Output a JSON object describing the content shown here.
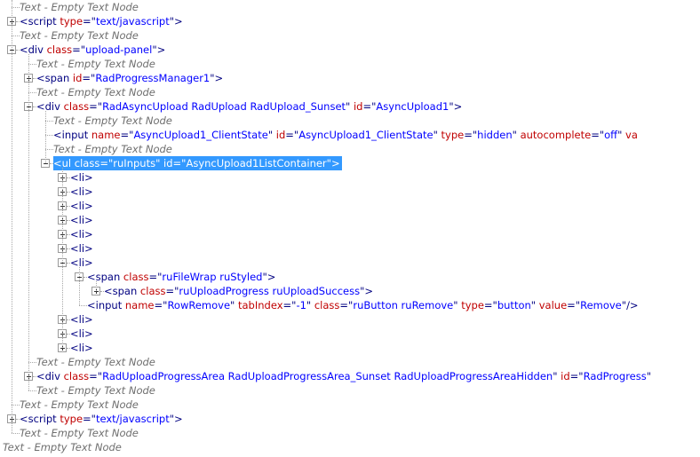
{
  "dom_tree": {
    "nodes": [
      {
        "depth": 0,
        "kind": "text",
        "text": "Text - Empty Text Node"
      },
      {
        "depth": 0,
        "kind": "element",
        "toggle": "collapsed",
        "tag": "script",
        "attrs": [
          {
            "name": "type",
            "value": "text/javascript"
          }
        ],
        "close": ">"
      },
      {
        "depth": 0,
        "kind": "text",
        "text": "Text - Empty Text Node"
      },
      {
        "depth": 0,
        "kind": "element",
        "toggle": "expanded",
        "tag": "div",
        "attrs": [
          {
            "name": "class",
            "value": "upload-panel"
          }
        ],
        "close": ">"
      },
      {
        "depth": 1,
        "kind": "text",
        "text": "Text - Empty Text Node"
      },
      {
        "depth": 1,
        "kind": "element",
        "toggle": "collapsed",
        "tag": "span",
        "attrs": [
          {
            "name": "id",
            "value": "RadProgressManager1"
          }
        ],
        "close": ">"
      },
      {
        "depth": 1,
        "kind": "text",
        "text": "Text - Empty Text Node"
      },
      {
        "depth": 1,
        "kind": "element",
        "toggle": "expanded",
        "tag": "div",
        "attrs": [
          {
            "name": "class",
            "value": "RadAsyncUpload RadUpload RadUpload_Sunset"
          },
          {
            "name": "id",
            "value": "AsyncUpload1"
          }
        ],
        "close": ">"
      },
      {
        "depth": 2,
        "kind": "text",
        "text": "Text - Empty Text Node"
      },
      {
        "depth": 2,
        "kind": "element",
        "toggle": "none",
        "tag": "input",
        "attrs": [
          {
            "name": "name",
            "value": "AsyncUpload1_ClientState"
          },
          {
            "name": "id",
            "value": "AsyncUpload1_ClientState"
          },
          {
            "name": "type",
            "value": "hidden"
          },
          {
            "name": "autocomplete",
            "value": "off"
          },
          {
            "name": "va",
            "value": null
          }
        ],
        "close": ""
      },
      {
        "depth": 2,
        "kind": "text",
        "text": "Text - Empty Text Node"
      },
      {
        "depth": 2,
        "kind": "element",
        "toggle": "expanded",
        "tag": "ul",
        "attrs": [
          {
            "name": "class",
            "value": "ruInputs"
          },
          {
            "name": "id",
            "value": "AsyncUpload1ListContainer"
          }
        ],
        "close": ">",
        "selected": true
      },
      {
        "depth": 3,
        "kind": "element",
        "toggle": "collapsed",
        "tag": "li",
        "attrs": [],
        "close": ">"
      },
      {
        "depth": 3,
        "kind": "element",
        "toggle": "collapsed",
        "tag": "li",
        "attrs": [],
        "close": ">"
      },
      {
        "depth": 3,
        "kind": "element",
        "toggle": "collapsed",
        "tag": "li",
        "attrs": [],
        "close": ">"
      },
      {
        "depth": 3,
        "kind": "element",
        "toggle": "collapsed",
        "tag": "li",
        "attrs": [],
        "close": ">"
      },
      {
        "depth": 3,
        "kind": "element",
        "toggle": "collapsed",
        "tag": "li",
        "attrs": [],
        "close": ">"
      },
      {
        "depth": 3,
        "kind": "element",
        "toggle": "collapsed",
        "tag": "li",
        "attrs": [],
        "close": ">"
      },
      {
        "depth": 3,
        "kind": "element",
        "toggle": "expanded",
        "tag": "li",
        "attrs": [],
        "close": ">"
      },
      {
        "depth": 4,
        "kind": "element",
        "toggle": "expanded",
        "tag": "span",
        "attrs": [
          {
            "name": "class",
            "value": "ruFileWrap ruStyled"
          }
        ],
        "close": ">"
      },
      {
        "depth": 5,
        "kind": "element",
        "toggle": "collapsed",
        "tag": "span",
        "attrs": [
          {
            "name": "class",
            "value": "ruUploadProgress ruUploadSuccess"
          }
        ],
        "close": ">"
      },
      {
        "depth": 4,
        "kind": "element",
        "toggle": "none",
        "tag": "input",
        "attrs": [
          {
            "name": "name",
            "value": "RowRemove"
          },
          {
            "name": "tabIndex",
            "value": "-1"
          },
          {
            "name": "class",
            "value": "ruButton ruRemove"
          },
          {
            "name": "type",
            "value": "button"
          },
          {
            "name": "value",
            "value": "Remove"
          }
        ],
        "close": "/>"
      },
      {
        "depth": 3,
        "kind": "element",
        "toggle": "collapsed",
        "tag": "li",
        "attrs": [],
        "close": ">"
      },
      {
        "depth": 3,
        "kind": "element",
        "toggle": "collapsed",
        "tag": "li",
        "attrs": [],
        "close": ">"
      },
      {
        "depth": 3,
        "kind": "element",
        "toggle": "collapsed",
        "tag": "li",
        "attrs": [],
        "close": ">"
      },
      {
        "depth": 1,
        "kind": "text",
        "text": "Text - Empty Text Node"
      },
      {
        "depth": 1,
        "kind": "element",
        "toggle": "collapsed",
        "tag": "div",
        "attrs": [
          {
            "name": "class",
            "value": "RadUploadProgressArea RadUploadProgressArea_Sunset RadUploadProgressAreaHidden"
          },
          {
            "name": "id",
            "value": "RadProgress"
          }
        ],
        "close": ""
      },
      {
        "depth": 1,
        "kind": "text",
        "text": "Text - Empty Text Node"
      },
      {
        "depth": 0,
        "kind": "text",
        "text": "Text - Empty Text Node"
      },
      {
        "depth": 0,
        "kind": "element",
        "toggle": "collapsed",
        "tag": "script",
        "attrs": [
          {
            "name": "type",
            "value": "text/javascript"
          }
        ],
        "close": ">"
      },
      {
        "depth": 0,
        "kind": "text",
        "text": "Text - Empty Text Node"
      },
      {
        "depth": -1,
        "kind": "text",
        "text": "Text - Empty Text Node"
      }
    ]
  }
}
